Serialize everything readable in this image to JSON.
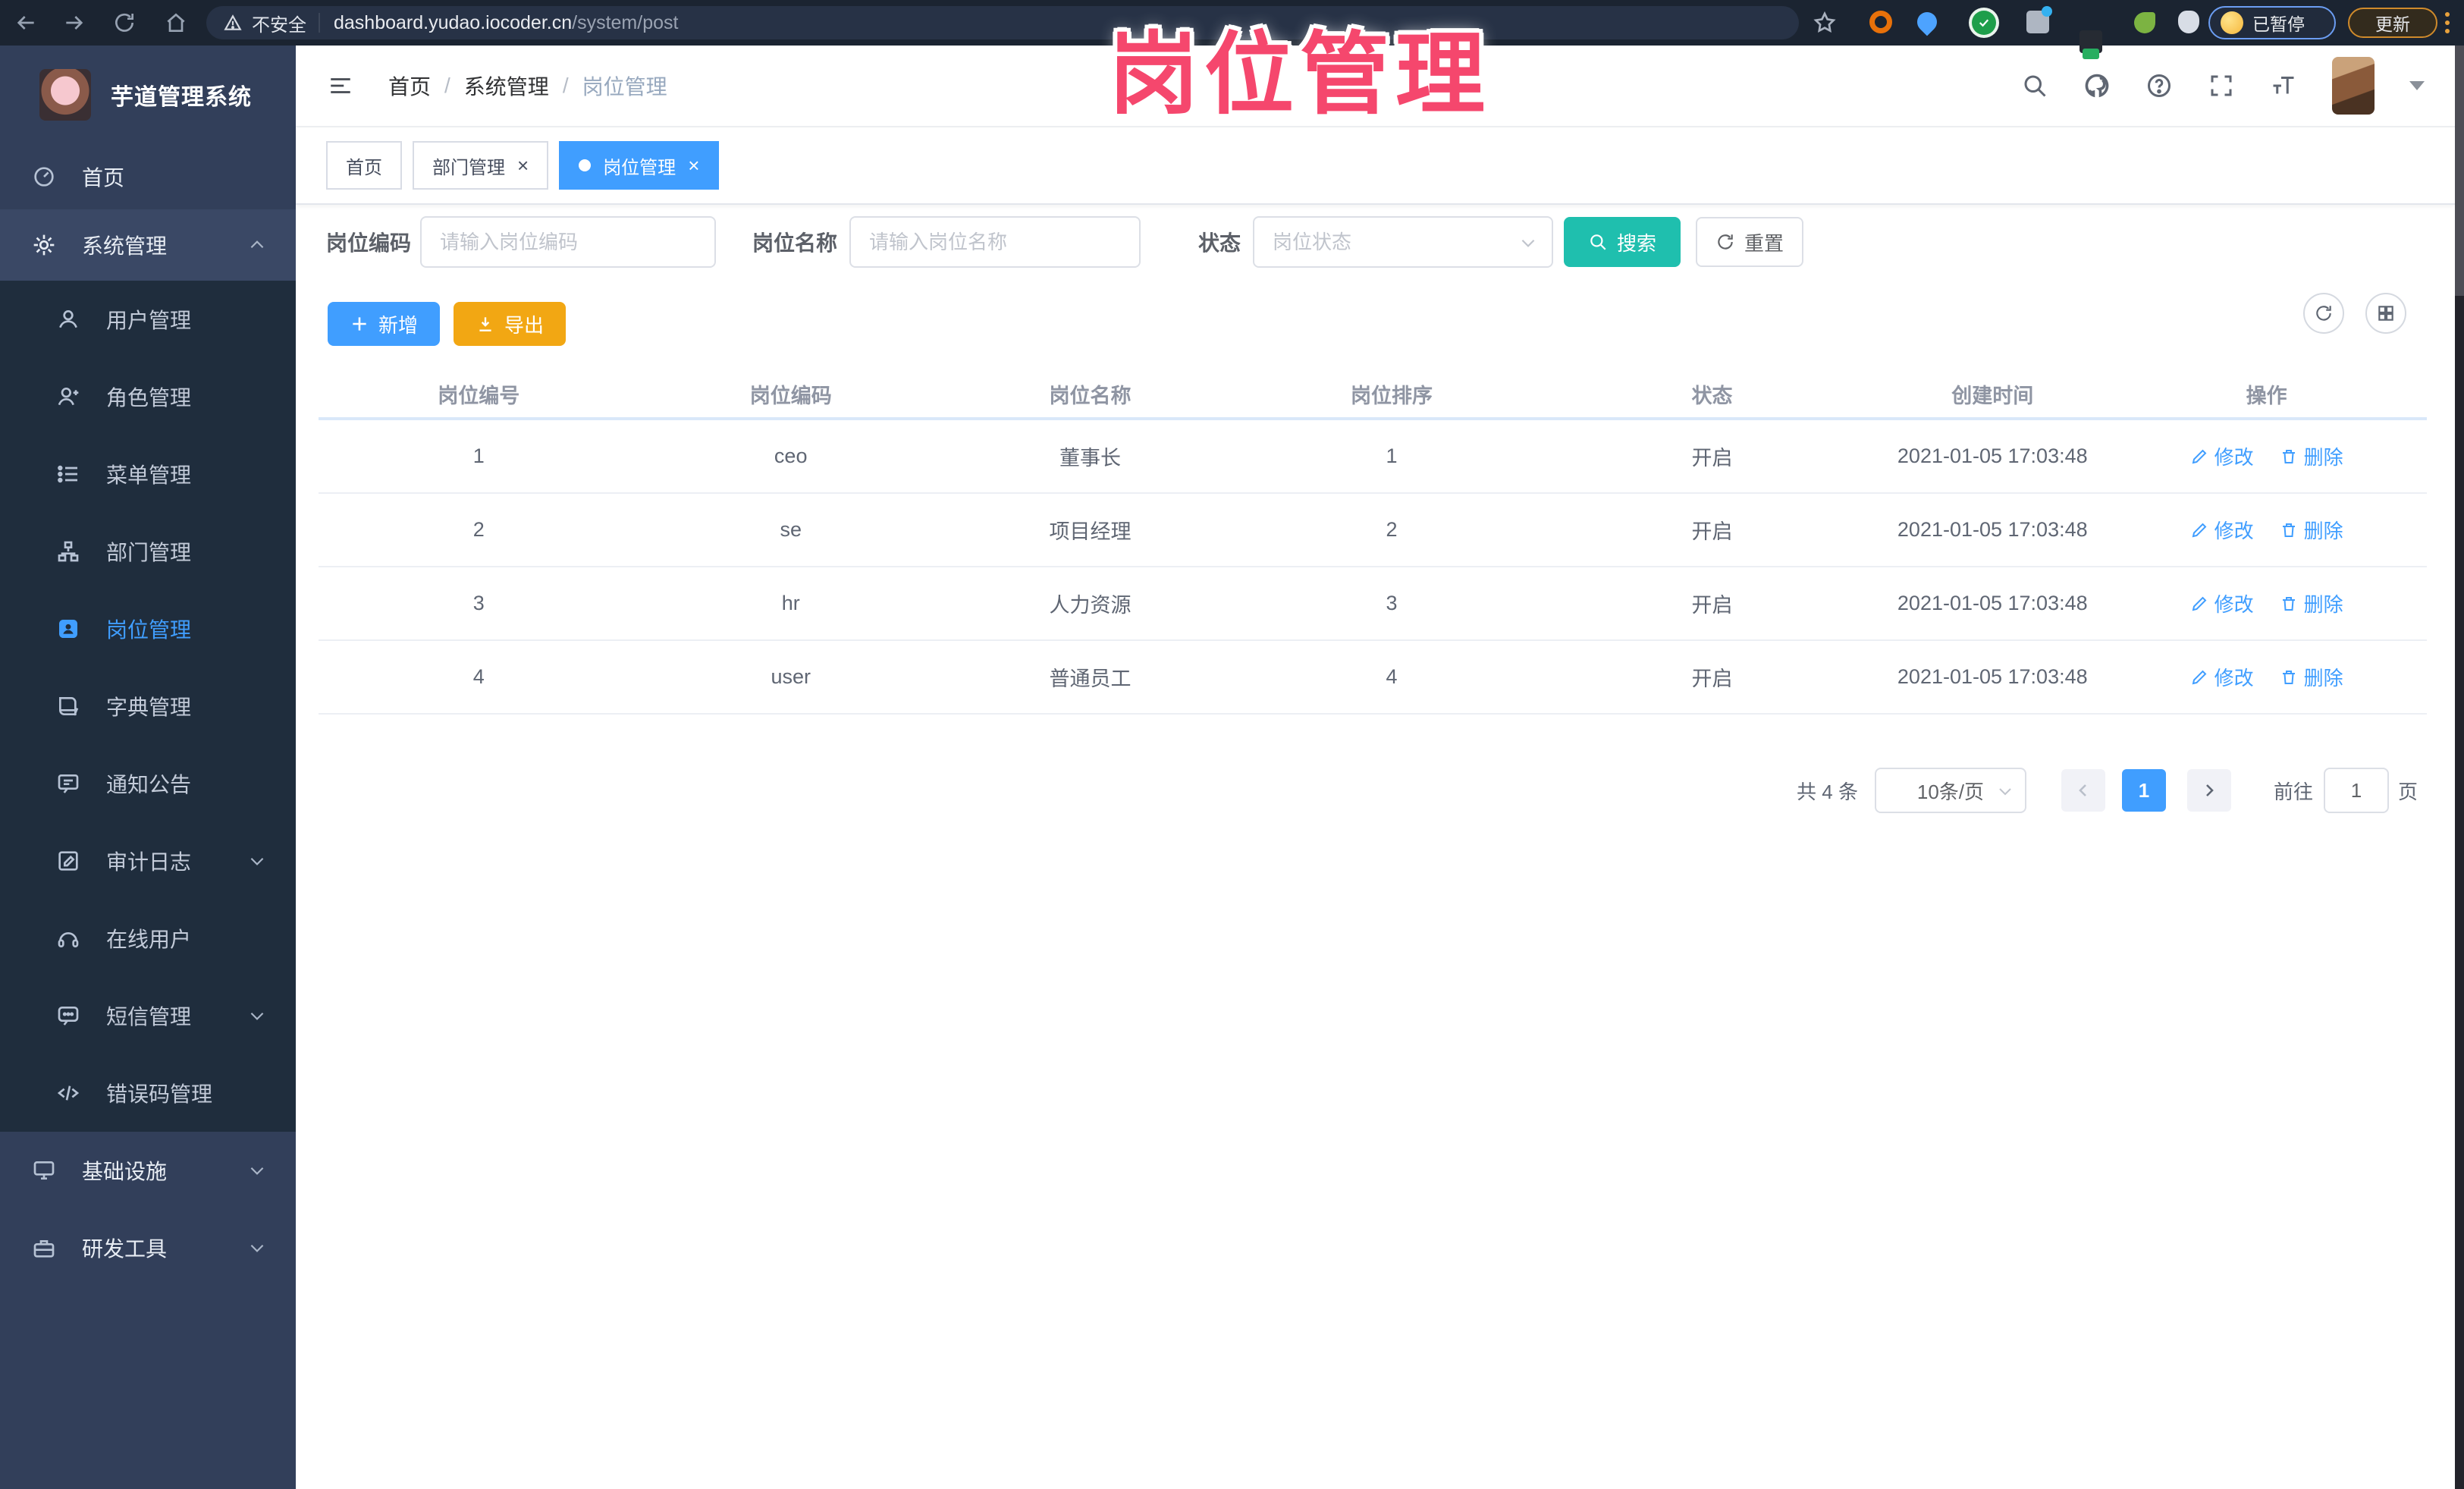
{
  "browser": {
    "security_label": "不安全",
    "url_domain": "dashboard.yudao.iocoder.cn",
    "url_path": "/system/post",
    "paused_badge": "已暂停",
    "update_label": "更新"
  },
  "overlay": {
    "title": "岗位管理"
  },
  "sidebar": {
    "app_title": "芋道管理系统",
    "home_label": "首页",
    "system_label": "系统管理",
    "submenu": [
      "用户管理",
      "角色管理",
      "菜单管理",
      "部门管理",
      "岗位管理",
      "字典管理",
      "通知公告",
      "审计日志",
      "在线用户",
      "短信管理",
      "错误码管理"
    ],
    "infra_label": "基础设施",
    "devtools_label": "研发工具"
  },
  "header": {
    "breadcrumb": [
      "首页",
      "系统管理",
      "岗位管理"
    ]
  },
  "tabs": [
    {
      "label": "首页"
    },
    {
      "label": "部门管理"
    },
    {
      "label": "岗位管理"
    }
  ],
  "filters": {
    "post_code_label": "岗位编码",
    "post_code_placeholder": "请输入岗位编码",
    "post_name_label": "岗位名称",
    "post_name_placeholder": "请输入岗位名称",
    "status_label": "状态",
    "status_placeholder": "岗位状态",
    "search_label": "搜索",
    "reset_label": "重置"
  },
  "toolbar": {
    "add_label": "新增",
    "export_label": "导出"
  },
  "table": {
    "columns": [
      "岗位编号",
      "岗位编码",
      "岗位名称",
      "岗位排序",
      "状态",
      "创建时间",
      "操作"
    ],
    "rows": [
      {
        "id": "1",
        "code": "ceo",
        "name": "董事长",
        "sort": "1",
        "status": "开启",
        "created": "2021-01-05 17:03:48"
      },
      {
        "id": "2",
        "code": "se",
        "name": "项目经理",
        "sort": "2",
        "status": "开启",
        "created": "2021-01-05 17:03:48"
      },
      {
        "id": "3",
        "code": "hr",
        "name": "人力资源",
        "sort": "3",
        "status": "开启",
        "created": "2021-01-05 17:03:48"
      },
      {
        "id": "4",
        "code": "user",
        "name": "普通员工",
        "sort": "4",
        "status": "开启",
        "created": "2021-01-05 17:03:48"
      }
    ],
    "edit_label": "修改",
    "delete_label": "删除"
  },
  "pagination": {
    "total_text": "共 4 条",
    "page_size": "10条/页",
    "current_page": "1",
    "goto_label": "前往",
    "goto_value": "1",
    "page_unit": "页"
  },
  "icons": {
    "browser": [
      "back-icon",
      "forward-icon",
      "reload-icon",
      "home-icon",
      "warning-icon",
      "star-icon",
      "extension-icons",
      "kebab-menu-icon"
    ],
    "navbar": [
      "hamburger-icon",
      "search-icon",
      "github-icon",
      "help-icon",
      "fullscreen-icon",
      "font-size-icon",
      "avatar",
      "caret-down-icon"
    ]
  },
  "colors": {
    "accent_blue": "#409EFF",
    "search_teal": "#1fbfae",
    "export_amber": "#f2a713",
    "overlay_pink": "#f5476d",
    "sidebar_bg": "#323f5a",
    "submenu_bg": "#1f2d3d"
  }
}
